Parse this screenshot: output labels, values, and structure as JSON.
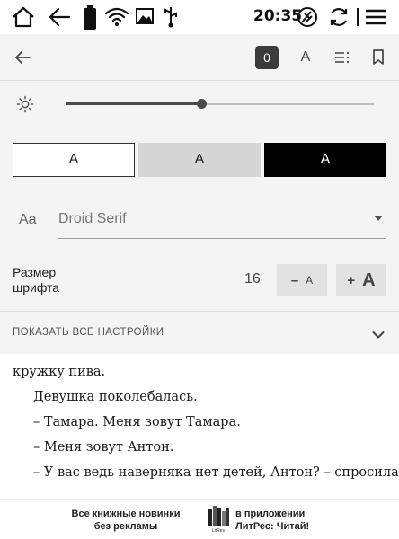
{
  "status_bar": {
    "time": "20:35",
    "icons": [
      "home-icon",
      "back-arrow-icon",
      "battery-icon",
      "wifi-icon",
      "image-icon",
      "usb-icon",
      "sync-icon",
      "refresh-icon",
      "menu-icon"
    ]
  },
  "toolbar": {
    "back_icon": "arrow-left-icon",
    "zero_label": "0",
    "font_label": "A",
    "toc_icon": "list-icon",
    "bookmark_icon": "bookmark-icon"
  },
  "brightness": {
    "icon": "sun-icon",
    "level": 0.44
  },
  "themes": [
    {
      "label": "A",
      "name": "white"
    },
    {
      "label": "A",
      "name": "gray"
    },
    {
      "label": "A",
      "name": "black"
    }
  ],
  "font": {
    "prefix": "Aa",
    "family": "Droid Serif"
  },
  "font_size": {
    "label_line1": "Размер",
    "label_line2": "шрифта",
    "value": "16",
    "decrease_symbol": "–",
    "decrease_letter": "A",
    "increase_symbol": "+",
    "increase_letter": "A"
  },
  "show_all": {
    "label": "ПОКАЗАТЬ ВСЕ НАСТРОЙКИ"
  },
  "book": {
    "lines": [
      "кружку пива.",
      "Девушка поколебалась.",
      "– Тамара. Меня зовут Тамара.",
      "– Меня зовут Антон.",
      "– У вас ведь наверняка нет детей, Антон? – спросила Та-"
    ]
  },
  "ad": {
    "left_line1": "Все книжные новинки",
    "left_line2": "без рекламы",
    "logo_text": "LitRes",
    "right_line1": "в приложении",
    "right_line2": "ЛитРес: Читай!"
  },
  "colors": {
    "panel_bg": "#f4f4f4",
    "accent_dark": "#3b3b3b",
    "theme_gray": "#d6d6d6"
  }
}
